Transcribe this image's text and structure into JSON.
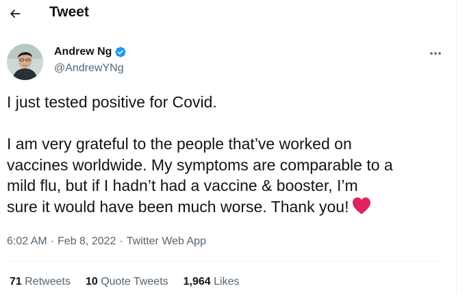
{
  "header": {
    "back_icon": "arrow-left-icon",
    "title": "Tweet"
  },
  "author": {
    "name": "Andrew Ng",
    "handle": "@AndrewYNg",
    "verified_icon": "verified-badge-icon",
    "verified_color": "#1d9bf0"
  },
  "more_icon": "more-horizontal-icon",
  "tweet": {
    "lines": [
      "I just tested positive for Covid.",
      "I am very grateful to the people that’ve worked on",
      "vaccines worldwide. My symptoms are comparable to a",
      "mild flu, but if I hadn’t had a vaccine & booster, I’m",
      "sure it would have been much worse. Thank you!"
    ],
    "emoji_icon": "red-heart-icon",
    "emoji_color": "#e0245e"
  },
  "meta": {
    "time": "6:02 AM",
    "separator": "·",
    "date": "Feb 8, 2022",
    "source": "Twitter Web App"
  },
  "stats": {
    "retweets_count": "71",
    "retweets_label": "Retweets",
    "quotes_count": "10",
    "quotes_label": "Quote Tweets",
    "likes_count": "1,964",
    "likes_label": "Likes"
  }
}
